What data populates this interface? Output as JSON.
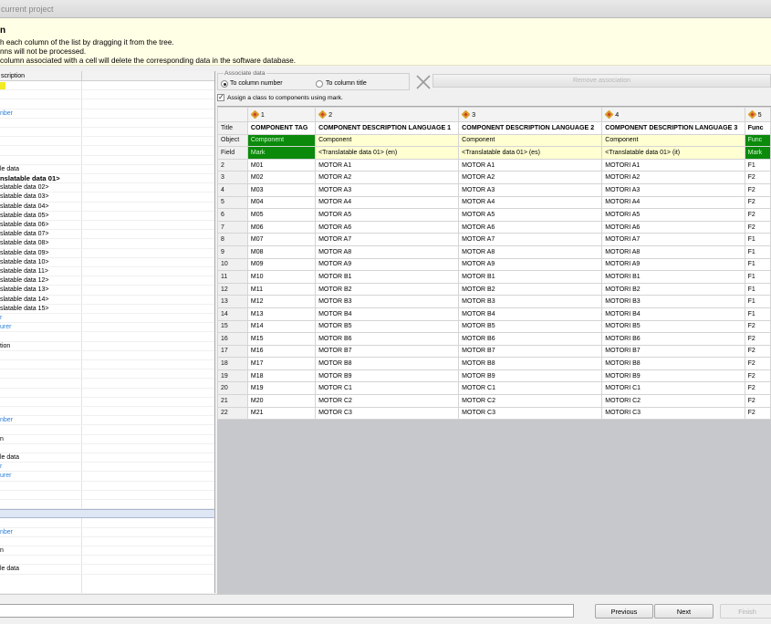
{
  "window": {
    "title": "current project"
  },
  "info": {
    "title": "n",
    "lines": [
      "h each column of the list by dragging it from the tree.",
      "nns will not be processed.",
      "column associated with a cell will delete the corresponding data in the software database."
    ]
  },
  "tree": {
    "header": "scription",
    "rows": [
      {
        "text": "",
        "style": "mark"
      },
      {
        "text": "",
        "style": ""
      },
      {
        "text": "",
        "style": ""
      },
      {
        "text": "nber",
        "style": "blue"
      },
      {
        "text": "",
        "style": ""
      },
      {
        "text": "",
        "style": ""
      },
      {
        "text": "",
        "style": ""
      },
      {
        "text": "",
        "style": ""
      },
      {
        "text": "",
        "style": ""
      },
      {
        "text": "le data",
        "style": ""
      },
      {
        "text": "nslatable data 01>",
        "style": "bold"
      },
      {
        "text": "slatable data 02>",
        "style": ""
      },
      {
        "text": "slatable data 03>",
        "style": ""
      },
      {
        "text": "slatable data 04>",
        "style": ""
      },
      {
        "text": "slatable data 05>",
        "style": ""
      },
      {
        "text": "slatable data 06>",
        "style": ""
      },
      {
        "text": "slatable data 07>",
        "style": ""
      },
      {
        "text": "slatable data 08>",
        "style": ""
      },
      {
        "text": "slatable data 09>",
        "style": ""
      },
      {
        "text": "slatable data 10>",
        "style": ""
      },
      {
        "text": "slatable data 11>",
        "style": ""
      },
      {
        "text": "slatable data 12>",
        "style": ""
      },
      {
        "text": "slatable data 13>",
        "style": ""
      },
      {
        "text": "slatable data 14>",
        "style": ""
      },
      {
        "text": "slatable data 15>",
        "style": ""
      },
      {
        "text": "r",
        "style": "blue"
      },
      {
        "text": "urer",
        "style": "blue"
      },
      {
        "text": "",
        "style": ""
      },
      {
        "text": "tion",
        "style": ""
      },
      {
        "text": "",
        "style": ""
      },
      {
        "text": "",
        "style": ""
      },
      {
        "text": "",
        "style": ""
      },
      {
        "text": "",
        "style": ""
      },
      {
        "text": "",
        "style": ""
      },
      {
        "text": "",
        "style": ""
      },
      {
        "text": "",
        "style": ""
      },
      {
        "text": "nber",
        "style": "blue"
      },
      {
        "text": "",
        "style": ""
      },
      {
        "text": "n",
        "style": ""
      },
      {
        "text": "",
        "style": ""
      },
      {
        "text": "le data",
        "style": ""
      },
      {
        "text": "r",
        "style": "blue"
      },
      {
        "text": "urer",
        "style": "blue"
      },
      {
        "text": "",
        "style": ""
      },
      {
        "text": "",
        "style": ""
      },
      {
        "text": "",
        "style": ""
      },
      {
        "text": "",
        "style": "selected"
      },
      {
        "text": "",
        "style": ""
      },
      {
        "text": "nber",
        "style": "blue"
      },
      {
        "text": "",
        "style": ""
      },
      {
        "text": "n",
        "style": ""
      },
      {
        "text": "",
        "style": ""
      },
      {
        "text": "le data",
        "style": ""
      }
    ]
  },
  "associate": {
    "legend": "Associate data",
    "by_number": "To column number",
    "by_title": "To column title",
    "remove": "Remove association"
  },
  "assign_class": "Assign a class to components using mark.",
  "grid": {
    "row_labels": {
      "title": "Title",
      "object": "Object",
      "field": "Field"
    },
    "columns": [
      {
        "num": "1",
        "title": "COMPONENT TAG",
        "object": "Component",
        "field": "Mark",
        "green": true
      },
      {
        "num": "2",
        "title": "COMPONENT DESCRIPTION LANGUAGE 1",
        "object": "Component",
        "field": "<Translatable data 01> (en)",
        "green": false
      },
      {
        "num": "3",
        "title": "COMPONENT DESCRIPTION LANGUAGE 2",
        "object": "Component",
        "field": "<Translatable data 01> (es)",
        "green": false
      },
      {
        "num": "4",
        "title": "COMPONENT DESCRIPTION LANGUAGE 3",
        "object": "Component",
        "field": "<Translatable data 01> (it)",
        "green": false
      },
      {
        "num": "5",
        "title": "Func",
        "object": "Func",
        "field": "Mark",
        "green": true
      }
    ],
    "rows": [
      [
        "2",
        "M01",
        "MOTOR A1",
        "MOTOR A1",
        "MOTORI A1",
        "F1"
      ],
      [
        "3",
        "M02",
        "MOTOR A2",
        "MOTOR A2",
        "MOTORI A2",
        "F2"
      ],
      [
        "4",
        "M03",
        "MOTOR A3",
        "MOTOR A3",
        "MOTORI A3",
        "F2"
      ],
      [
        "5",
        "M04",
        "MOTOR A4",
        "MOTOR A4",
        "MOTORI A4",
        "F2"
      ],
      [
        "6",
        "M05",
        "MOTOR A5",
        "MOTOR A5",
        "MOTORI A5",
        "F2"
      ],
      [
        "7",
        "M06",
        "MOTOR A6",
        "MOTOR A6",
        "MOTORI A6",
        "F2"
      ],
      [
        "8",
        "M07",
        "MOTOR A7",
        "MOTOR A7",
        "MOTORI A7",
        "F1"
      ],
      [
        "9",
        "M08",
        "MOTOR A8",
        "MOTOR A8",
        "MOTORI A8",
        "F1"
      ],
      [
        "10",
        "M09",
        "MOTOR A9",
        "MOTOR A9",
        "MOTORI A9",
        "F1"
      ],
      [
        "11",
        "M10",
        "MOTOR B1",
        "MOTOR B1",
        "MOTORI B1",
        "F1"
      ],
      [
        "12",
        "M11",
        "MOTOR B2",
        "MOTOR B2",
        "MOTORI B2",
        "F1"
      ],
      [
        "13",
        "M12",
        "MOTOR B3",
        "MOTOR B3",
        "MOTORI B3",
        "F1"
      ],
      [
        "14",
        "M13",
        "MOTOR B4",
        "MOTOR B4",
        "MOTORI B4",
        "F1"
      ],
      [
        "15",
        "M14",
        "MOTOR B5",
        "MOTOR B5",
        "MOTORI B5",
        "F2"
      ],
      [
        "16",
        "M15",
        "MOTOR B6",
        "MOTOR B6",
        "MOTORI B6",
        "F2"
      ],
      [
        "17",
        "M16",
        "MOTOR B7",
        "MOTOR B7",
        "MOTORI B7",
        "F2"
      ],
      [
        "18",
        "M17",
        "MOTOR B8",
        "MOTOR B8",
        "MOTORI B8",
        "F2"
      ],
      [
        "19",
        "M18",
        "MOTOR B9",
        "MOTOR B9",
        "MOTORI B9",
        "F2"
      ],
      [
        "20",
        "M19",
        "MOTOR C1",
        "MOTOR C1",
        "MOTORI C1",
        "F2"
      ],
      [
        "21",
        "M20",
        "MOTOR C2",
        "MOTOR C2",
        "MOTORI C2",
        "F2"
      ],
      [
        "22",
        "M21",
        "MOTOR C3",
        "MOTOR C3",
        "MOTORI C3",
        "F2"
      ]
    ]
  },
  "buttons": {
    "previous": "Previous",
    "next": "Next",
    "finish": "Finish"
  },
  "colors": {
    "mapped": "#0b8a0b",
    "highlight": "#ffffd2",
    "link": "#2f7fd6"
  }
}
